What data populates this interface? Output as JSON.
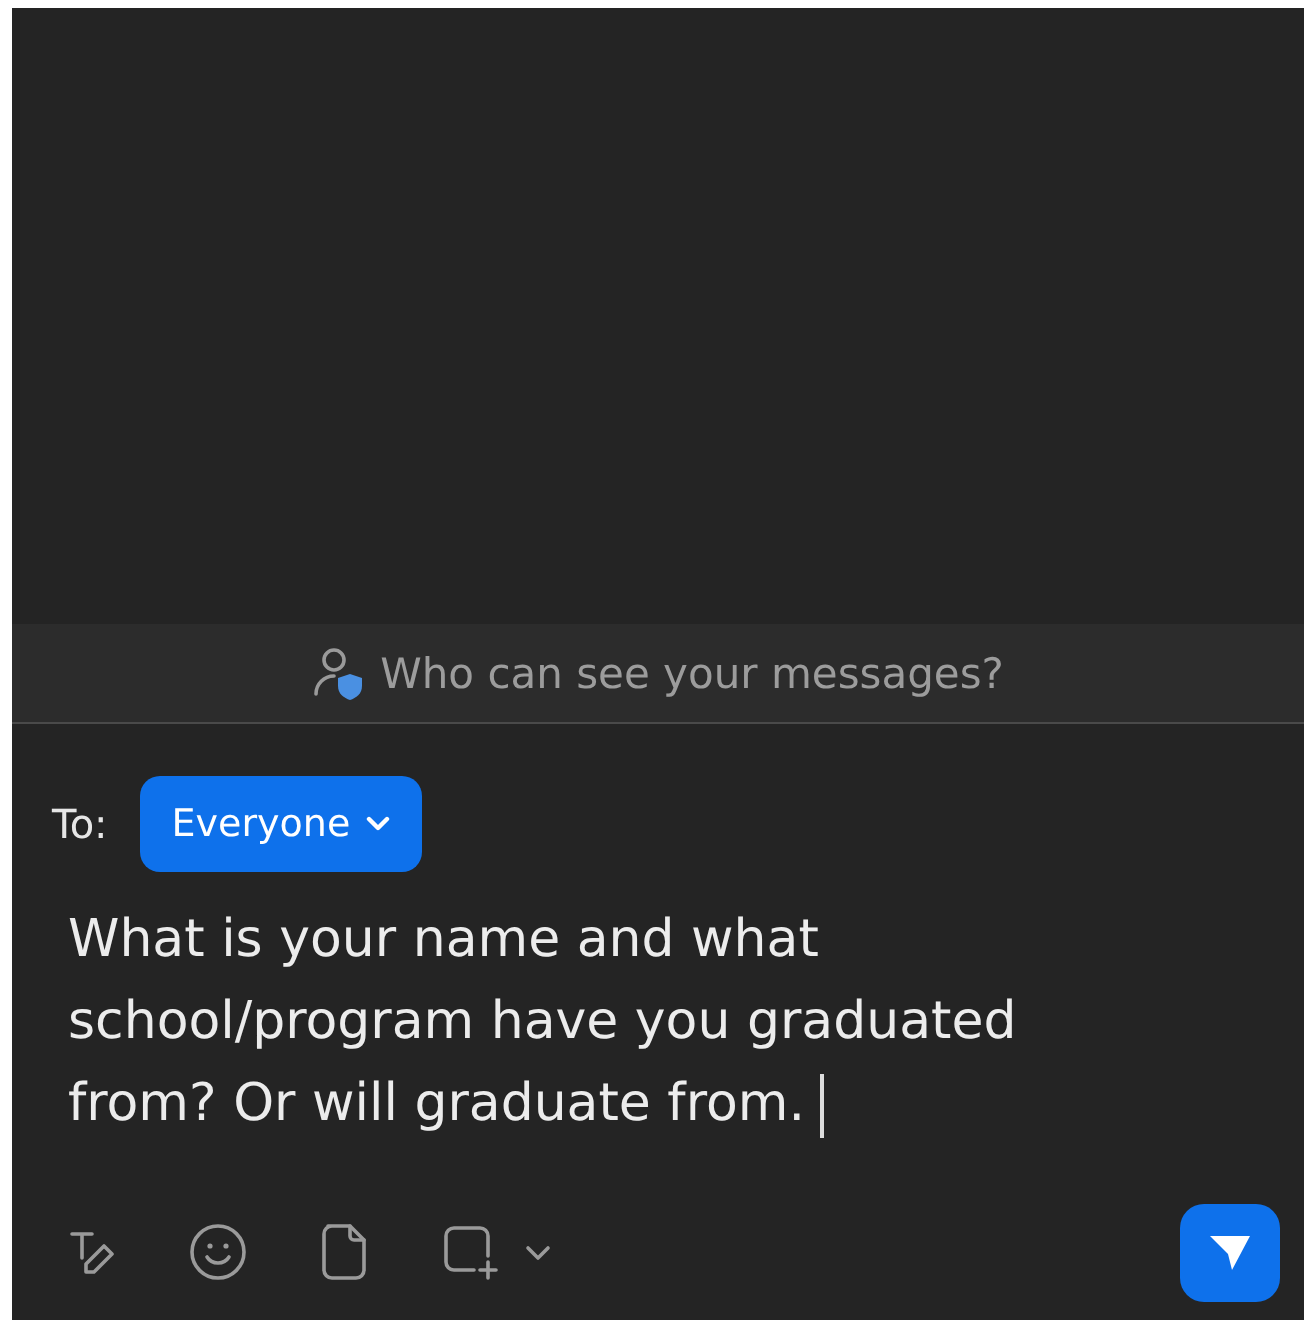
{
  "privacy_banner": {
    "text": "Who can see your messages?"
  },
  "recipient": {
    "label": "To:",
    "value": "Everyone"
  },
  "message": {
    "value": "What is your name and what school/program have you graduated from? Or will graduate from."
  }
}
